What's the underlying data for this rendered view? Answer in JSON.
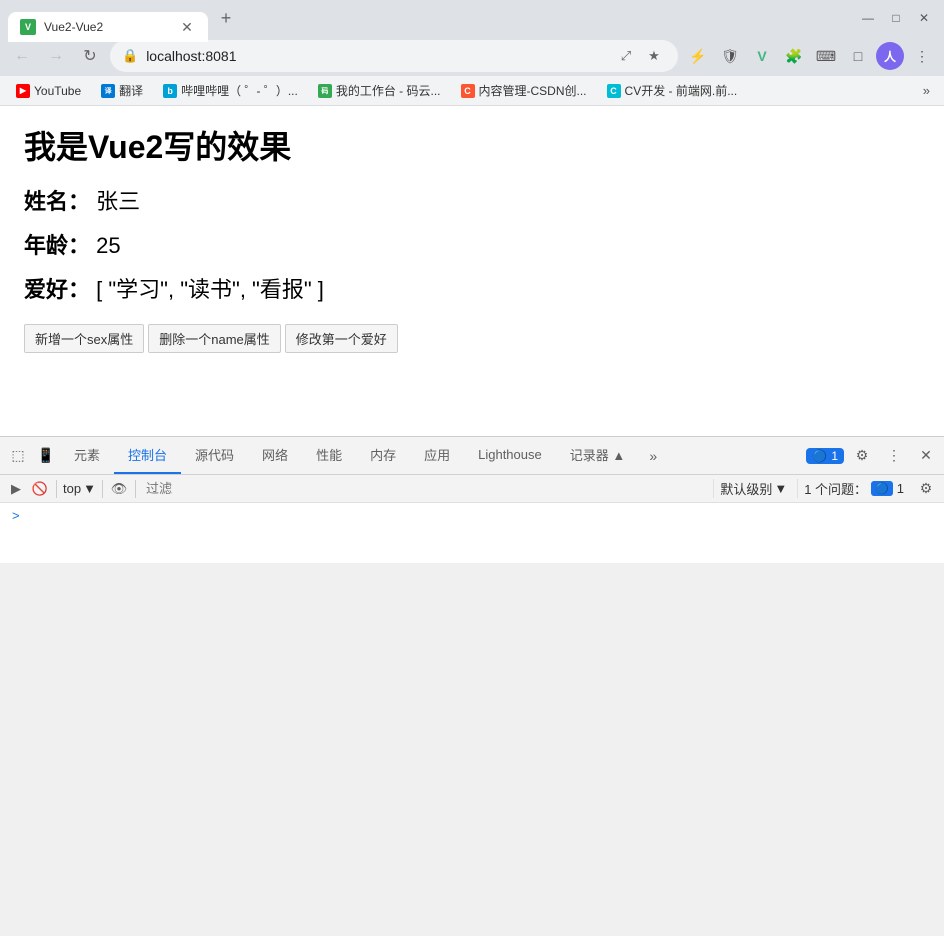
{
  "browser": {
    "tab": {
      "title": "Vue2-Vue2",
      "favicon_text": "V"
    },
    "new_tab_icon": "+",
    "window_controls": {
      "minimize": "—",
      "maximize": "□",
      "close": "✕"
    },
    "nav": {
      "back": "←",
      "forward": "→",
      "reload": "↻",
      "url": "localhost:8081",
      "url_display": "localhost:8081"
    },
    "toolbar_icons": [
      "⤢",
      "★",
      "👁",
      "⚡",
      "🛡",
      "V",
      "🧩",
      "⌨",
      "□",
      "👤",
      "⋮"
    ],
    "bookmarks": [
      {
        "label": "YouTube",
        "favicon": "▶",
        "class": "bm-yt"
      },
      {
        "label": "翻译",
        "favicon": "译",
        "class": "bm-ms"
      },
      {
        "label": "哔哩哔哩（ ゜- ゜）...",
        "favicon": "b",
        "class": "bm-bili"
      },
      {
        "label": "我的工作台 - 码云...",
        "favicon": "码",
        "class": "bm-green"
      },
      {
        "label": "内容管理-CSDN创...",
        "favicon": "C",
        "class": "bm-csdn"
      },
      {
        "label": "CV开发 - 前端网.前...",
        "favicon": "C",
        "class": "bm-cyan"
      }
    ],
    "more_bookmarks": "»"
  },
  "page": {
    "title": "我是Vue2写的效果",
    "name_label": "姓名：",
    "name_value": "张三",
    "age_label": "年龄：",
    "age_value": "25",
    "hobby_label": "爱好：",
    "hobby_value": "[ \"学习\", \"读书\", \"看报\" ]",
    "buttons": [
      {
        "label": "新增一个sex属性"
      },
      {
        "label": "删除一个name属性"
      },
      {
        "label": "修改第一个爱好"
      }
    ]
  },
  "devtools": {
    "tabs": [
      {
        "label": "元素",
        "active": false
      },
      {
        "label": "控制台",
        "active": true
      },
      {
        "label": "源代码",
        "active": false
      },
      {
        "label": "网络",
        "active": false
      },
      {
        "label": "性能",
        "active": false
      },
      {
        "label": "内存",
        "active": false
      },
      {
        "label": "应用",
        "active": false
      },
      {
        "label": "Lighthouse",
        "active": false
      },
      {
        "label": "记录器 ▲",
        "active": false
      }
    ],
    "more_tabs": "»",
    "badge_count": "1",
    "badge_icon": "🔵",
    "settings_icon": "⚙",
    "more_icon": "⋮",
    "close_icon": "✕",
    "toolbar": {
      "run_icon": "▶",
      "block_icon": "🚫",
      "top_label": "top",
      "dropdown_icon": "▼",
      "eye_icon": "👁",
      "filter_placeholder": "过滤",
      "log_level": "默认级别",
      "log_level_dropdown": "▼",
      "issues_text": "1 个问题：",
      "issues_count": "1",
      "settings_icon": "⚙"
    },
    "console_arrow": ">"
  }
}
